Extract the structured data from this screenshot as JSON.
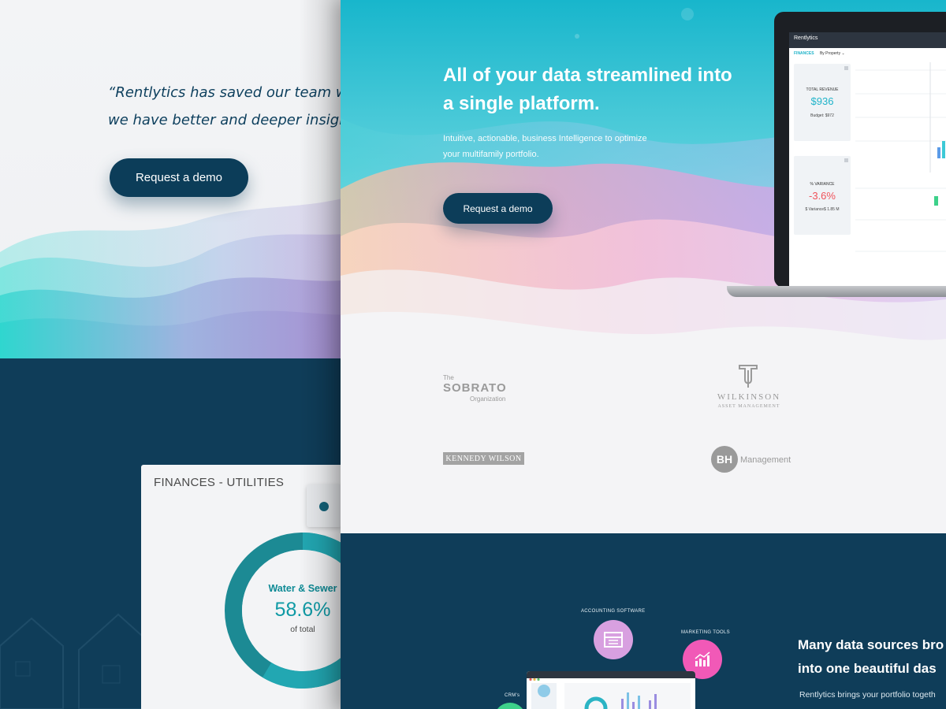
{
  "left_page": {
    "quote_line1": "“Rentlytics has saved our team we",
    "quote_line2": "we have better and deeper insigh",
    "demo_button": "Request a demo",
    "finances_card": {
      "title": "FINANCES - UTILITIES",
      "donut_label": "Water & Sewer",
      "donut_value": "58.6%",
      "donut_value_fraction": 0.586,
      "donut_sub": "of total"
    }
  },
  "right_page": {
    "hero": {
      "title_line1": "All of your data streamlined into",
      "title_line2": "a single platform.",
      "subtitle_line1": "Intuitive, actionable, business Intelligence to optimize",
      "subtitle_line2": "your multifamily portfolio.",
      "demo_button": "Request a demo"
    },
    "laptop": {
      "brand": "Rentlytics",
      "tab_active": "FINANCES",
      "tab_filter": "By Property ⌄",
      "kpi_revenue": {
        "label": "TOTAL REVENUE",
        "value": "$936",
        "footer": "Budget: $972"
      },
      "kpi_variance": {
        "label": "% VARIANCE",
        "value": "-3.6%",
        "footer": "$ Variance$ 1.85 M"
      }
    },
    "logos": {
      "sobrato_the": "The",
      "sobrato_main": "SOBRATO",
      "sobrato_org": "Organization",
      "wilkinson_main": "WILKINSON",
      "wilkinson_sub": "ASSET MANAGEMENT",
      "kennedy": "KENNEDY WILSON",
      "bh_mark": "BH",
      "bh_text": "Management"
    },
    "integrations": {
      "accounting_label": "ACCOUNTING SOFTWARE",
      "marketing_label": "MARKETING TOOLS",
      "crm_label": "CRM's",
      "title_line1": "Many data sources bro",
      "title_line2": "into one beautiful das",
      "subtitle": "Rentlytics brings your portfolio togeth"
    }
  },
  "colors": {
    "navy": "#0c3d59",
    "teal": "#1fb3c9",
    "negative": "#f0525a",
    "accounting": "#d8a0e0",
    "marketing": "#f159b7",
    "crm": "#3dd18a"
  }
}
